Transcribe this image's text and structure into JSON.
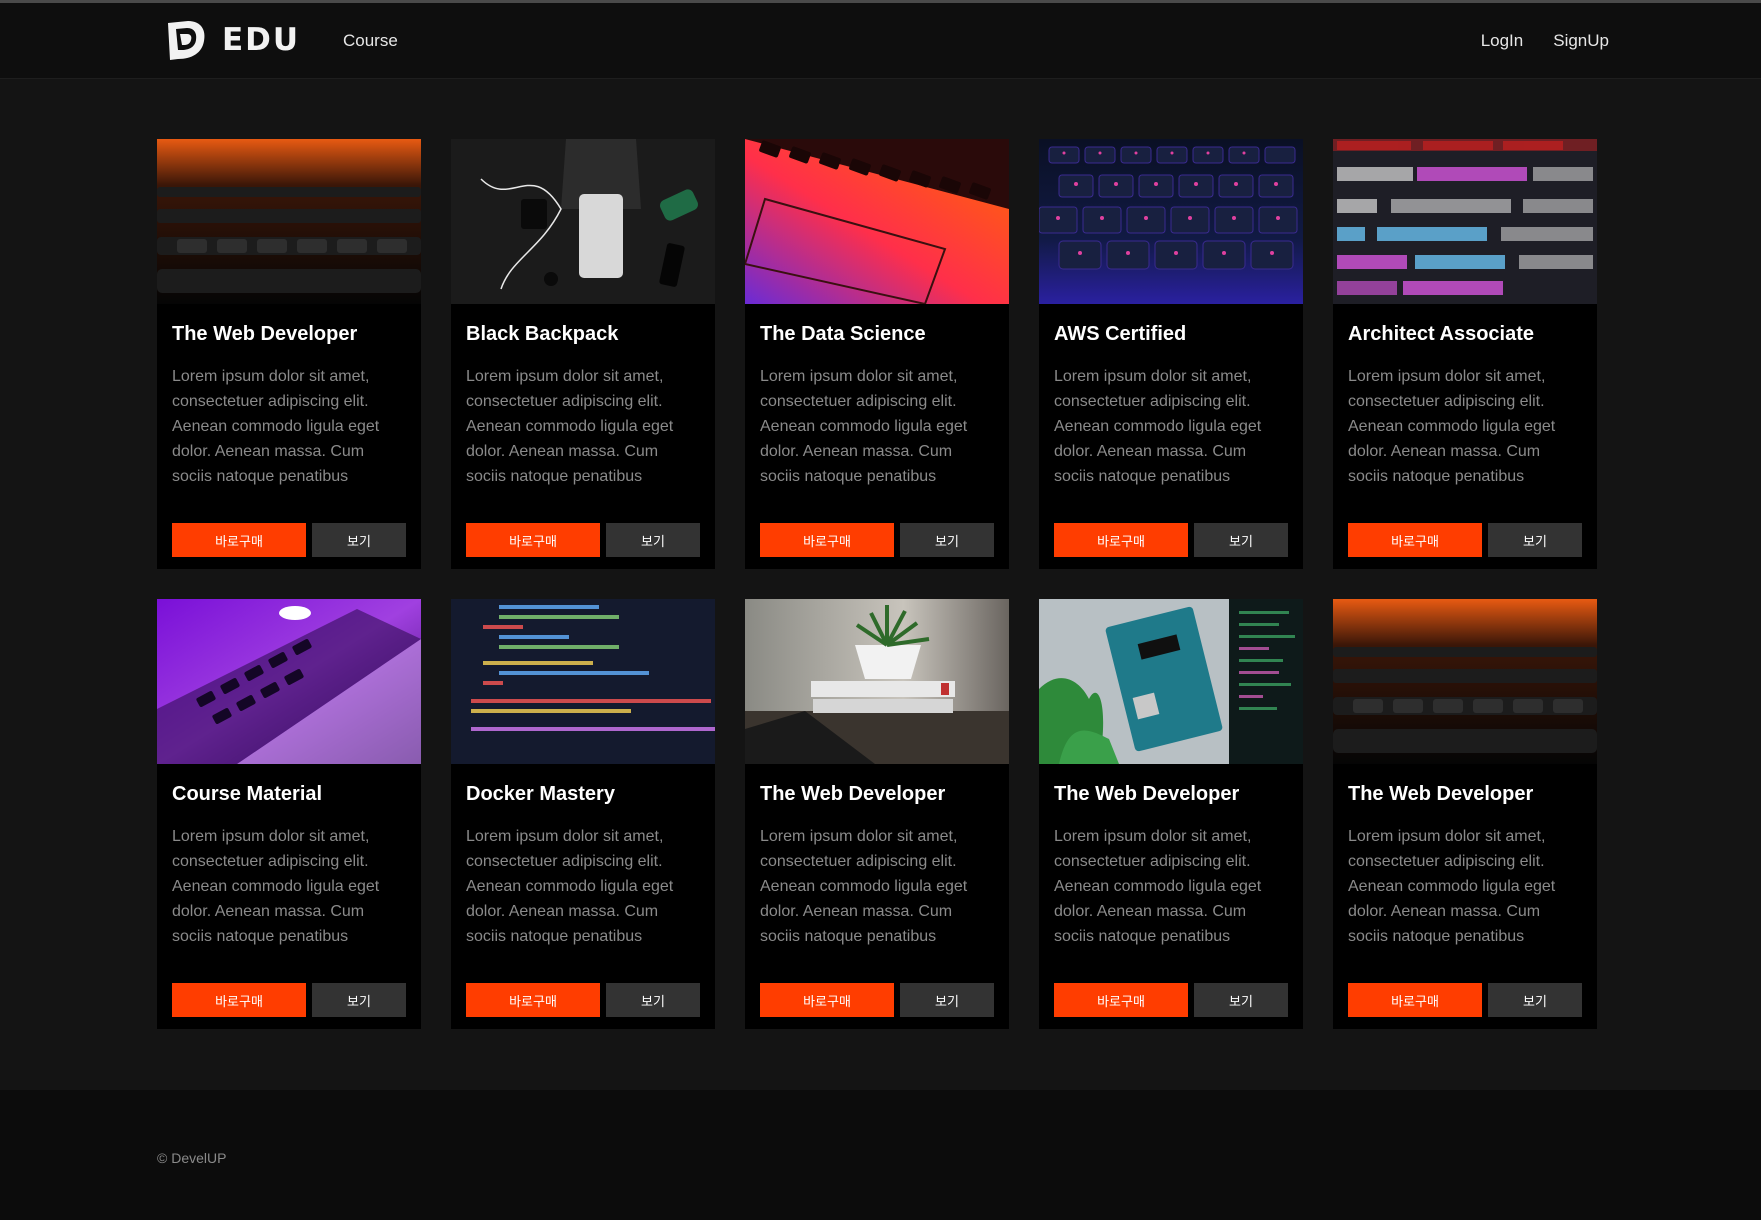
{
  "header": {
    "logo_text": "EDU",
    "nav_course": "Course",
    "login": "LogIn",
    "signup": "SignUp"
  },
  "cards": [
    {
      "title": "The Web Developer",
      "description": "Lorem ipsum dolor sit amet, consectetuer adipiscing elit. Aenean commodo ligula eget dolor. Aenean massa. Cum sociis natoque penatibus",
      "buy_label": "바로구매",
      "view_label": "보기"
    },
    {
      "title": "Black Backpack",
      "description": "Lorem ipsum dolor sit amet, consectetuer adipiscing elit. Aenean commodo ligula eget dolor. Aenean massa. Cum sociis natoque penatibus",
      "buy_label": "바로구매",
      "view_label": "보기"
    },
    {
      "title": "The Data Science",
      "description": "Lorem ipsum dolor sit amet, consectetuer adipiscing elit. Aenean commodo ligula eget dolor. Aenean massa. Cum sociis natoque penatibus",
      "buy_label": "바로구매",
      "view_label": "보기"
    },
    {
      "title": "AWS Certified",
      "description": "Lorem ipsum dolor sit amet, consectetuer adipiscing elit. Aenean commodo ligula eget dolor. Aenean massa. Cum sociis natoque penatibus",
      "buy_label": "바로구매",
      "view_label": "보기"
    },
    {
      "title": "Architect Associate",
      "description": "Lorem ipsum dolor sit amet, consectetuer adipiscing elit. Aenean commodo ligula eget dolor. Aenean massa. Cum sociis natoque penatibus",
      "buy_label": "바로구매",
      "view_label": "보기"
    },
    {
      "title": "Course Material",
      "description": "Lorem ipsum dolor sit amet, consectetuer adipiscing elit. Aenean commodo ligula eget dolor. Aenean massa. Cum sociis natoque penatibus",
      "buy_label": "바로구매",
      "view_label": "보기"
    },
    {
      "title": "Docker Mastery",
      "description": "Lorem ipsum dolor sit amet, consectetuer adipiscing elit. Aenean commodo ligula eget dolor. Aenean massa. Cum sociis natoque penatibus",
      "buy_label": "바로구매",
      "view_label": "보기"
    },
    {
      "title": "The Web Developer",
      "description": "Lorem ipsum dolor sit amet, consectetuer adipiscing elit. Aenean commodo ligula eget dolor. Aenean massa. Cum sociis natoque penatibus",
      "buy_label": "바로구매",
      "view_label": "보기"
    },
    {
      "title": "The Web Developer",
      "description": "Lorem ipsum dolor sit amet, consectetuer adipiscing elit. Aenean commodo ligula eget dolor. Aenean massa. Cum sociis natoque penatibus",
      "buy_label": "바로구매",
      "view_label": "보기"
    },
    {
      "title": "The Web Developer",
      "description": "Lorem ipsum dolor sit amet, consectetuer adipiscing elit. Aenean commodo ligula eget dolor. Aenean massa. Cum sociis natoque penatibus",
      "buy_label": "바로구매",
      "view_label": "보기"
    }
  ],
  "footer": {
    "copyright": "© DevelUP"
  },
  "colors": {
    "accent": "#ff3d00",
    "view_button": "#333333",
    "card_bg": "#000000",
    "page_bg": "#141414"
  }
}
